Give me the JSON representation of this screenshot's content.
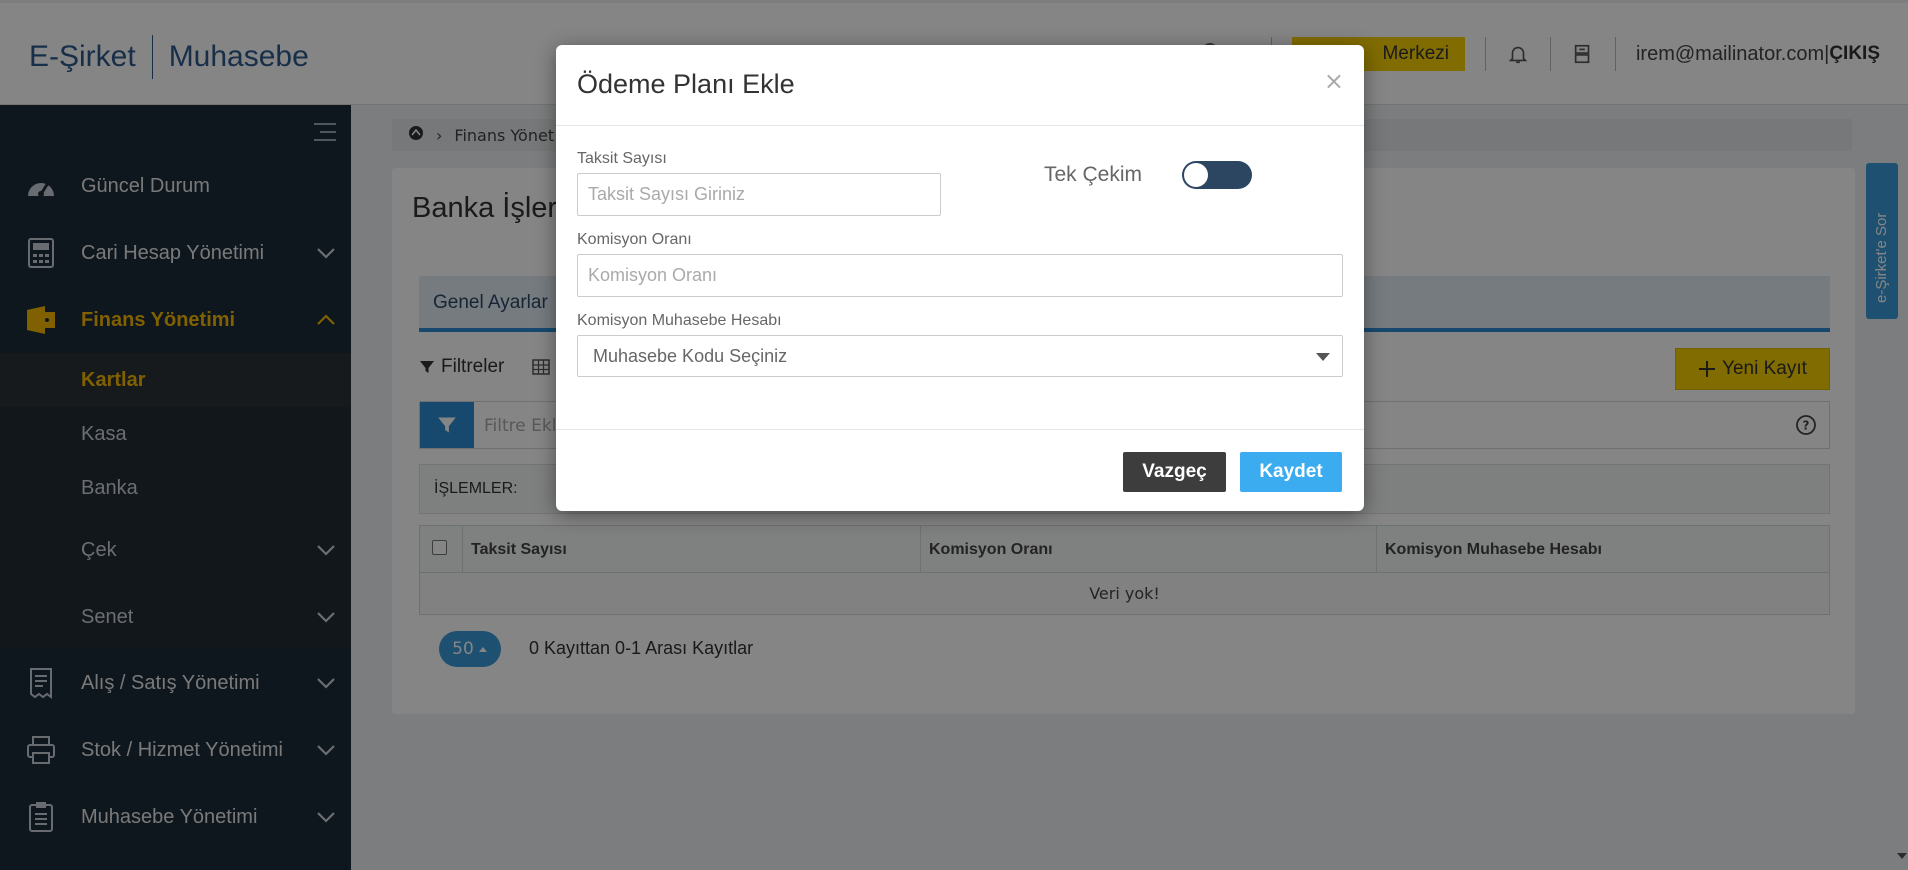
{
  "header": {
    "logo_left": "E-Şirket",
    "logo_right": "Muhasebe",
    "help_center_label": "Merkezi",
    "user_email": "irem@mailinator.com",
    "pipe": "|",
    "logout_label": "ÇIKIŞ"
  },
  "sidebar": {
    "items": [
      {
        "label": "Güncel Durum",
        "icon": "speedometer-icon"
      },
      {
        "label": "Cari Hesap Yönetimi",
        "icon": "calculator-icon"
      },
      {
        "label": "Finans Yönetimi",
        "icon": "finance-folder-icon"
      },
      {
        "label": "Alış / Satış Yönetimi",
        "icon": "receipt-icon"
      },
      {
        "label": "Stok / Hizmet Yönetimi",
        "icon": "printer-icon"
      },
      {
        "label": "Muhasebe Yönetimi",
        "icon": "clipboard-icon"
      }
    ],
    "sub_items": [
      {
        "label": "Kartlar"
      },
      {
        "label": "Kasa"
      },
      {
        "label": "Banka"
      },
      {
        "label": "Çek"
      },
      {
        "label": "Senet"
      }
    ],
    "active_color": "#f5b800"
  },
  "breadcrumb": {
    "item": "Finans Yönet"
  },
  "main": {
    "title": "Banka İşler",
    "tab_label": "Genel Ayarlar",
    "filters_label": "Filtreler",
    "new_record_label": "Yeni Kayıt",
    "filter_placeholder": "Filtre Ekle",
    "ops_label": "İŞLEMLER:",
    "table": {
      "columns": [
        "Taksit Sayısı",
        "Komisyon Oranı",
        "Komisyon Muhasebe Hesabı"
      ],
      "empty_text": "Veri yok!"
    },
    "pager": {
      "page_size": "50",
      "info": "0 Kayıttan 0-1 Arası Kayıtlar"
    }
  },
  "side_tab": {
    "label": "e-Şirket'e Sor"
  },
  "modal": {
    "title": "Ödeme Planı Ekle",
    "close": "×",
    "fields": {
      "taksit_label": "Taksit Sayısı",
      "taksit_placeholder": "Taksit Sayısı Giriniz",
      "tek_cekim_label": "Tek Çekim",
      "tek_cekim_on": false,
      "komisyon_label": "Komisyon Oranı",
      "komisyon_placeholder": "Komisyon Oranı",
      "hesap_label": "Komisyon Muhasebe Hesabı",
      "hesap_value": "Muhasebe Kodu Seçiniz"
    },
    "cancel_label": "Vazgeç",
    "save_label": "Kaydet"
  }
}
